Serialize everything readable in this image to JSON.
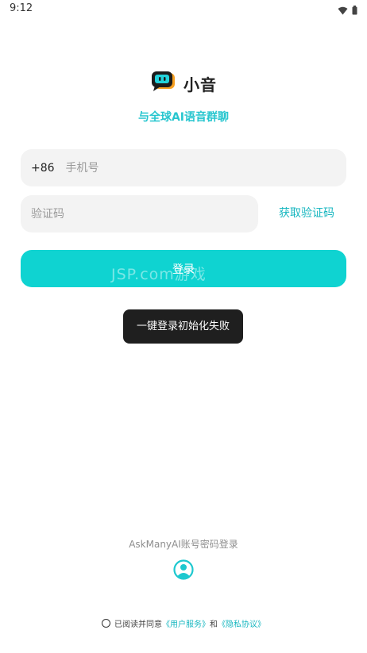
{
  "status_bar": {
    "time": "9:12",
    "icons": [
      "wifi-icon",
      "battery-icon"
    ]
  },
  "brand": {
    "logo_icon": "chat-bubble-logo-icon",
    "app_name": "小音",
    "slogan": "与全球AI语音群聊"
  },
  "form": {
    "country_code": "+86",
    "phone_placeholder": "手机号",
    "code_placeholder": "验证码",
    "get_code_label": "获取验证码",
    "login_label": "登录"
  },
  "watermark": "JSP.com游戏",
  "toast": "一键登录初始化失败",
  "alt_login": {
    "label": "AskManyAI账号密码登录",
    "icon": "user-avatar-icon"
  },
  "agreement": {
    "prefix": "已阅读并同意",
    "user_service": "《用户服务》",
    "conjunction": "和",
    "privacy": "《隐私协议》"
  },
  "colors": {
    "accent": "#0fd3d1",
    "link": "#18b7c0",
    "slogan": "#27c6cf",
    "field_bg": "#f3f3f3",
    "toast_bg": "#1f1f1f"
  }
}
